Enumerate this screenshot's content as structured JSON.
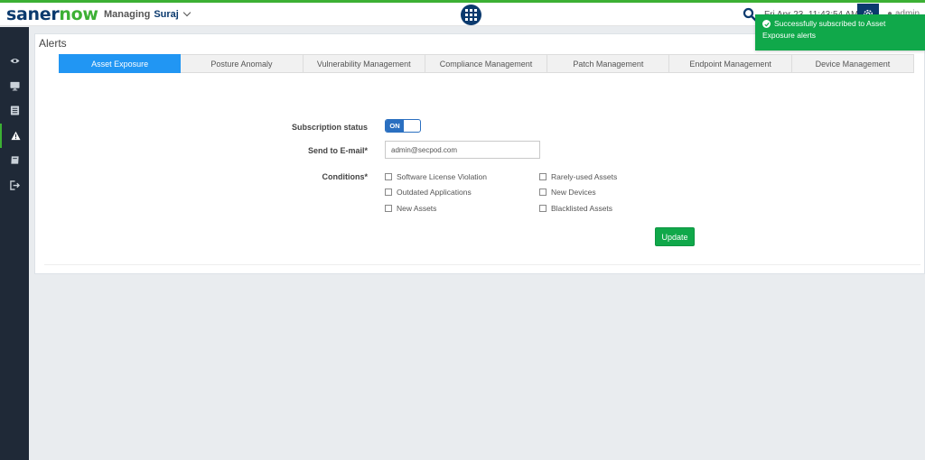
{
  "brand": {
    "logo_part1": "saner",
    "logo_part2": "now"
  },
  "header": {
    "managing_label": "Managing",
    "account": "Suraj",
    "datetime": "Fri Apr 23, 11:43:54 AM",
    "user": "admin"
  },
  "icons": {
    "apps": "grid-icon",
    "search": "search-icon",
    "settings": "gear-icon",
    "user": "user-icon",
    "success": "check-circle-icon"
  },
  "sidebar": {
    "items": [
      {
        "icon": "eye-icon",
        "active": false
      },
      {
        "icon": "monitor-icon",
        "active": false
      },
      {
        "icon": "report-icon",
        "active": false
      },
      {
        "icon": "warning-icon",
        "active": true
      },
      {
        "icon": "book-icon",
        "active": false
      },
      {
        "icon": "logout-icon",
        "active": false
      }
    ]
  },
  "page": {
    "title": "Alerts"
  },
  "tabs": [
    {
      "label": "Asset Exposure",
      "active": true
    },
    {
      "label": "Posture Anomaly",
      "active": false
    },
    {
      "label": "Vulnerability Management",
      "active": false
    },
    {
      "label": "Compliance Management",
      "active": false
    },
    {
      "label": "Patch Management",
      "active": false
    },
    {
      "label": "Endpoint Management",
      "active": false
    },
    {
      "label": "Device Management",
      "active": false
    }
  ],
  "form": {
    "subscription_label": "Subscription status",
    "subscription_value": "ON",
    "email_label": "Send to E-mail*",
    "email_value": "admin@secpod.com",
    "conditions_label": "Conditions*",
    "conditions": [
      {
        "label": "Software License Violation",
        "checked": false
      },
      {
        "label": "Outdated Applications",
        "checked": false
      },
      {
        "label": "New Assets",
        "checked": false
      },
      {
        "label": "Rarely-used Assets",
        "checked": false
      },
      {
        "label": "New Devices",
        "checked": false
      },
      {
        "label": "Blacklisted Assets",
        "checked": false
      }
    ],
    "update_label": "Update"
  },
  "toast": {
    "line1": "Successfully subscribed to Asset",
    "line2": "Exposure alerts"
  },
  "colors": {
    "brand_navy": "#0b3a6e",
    "brand_green": "#3cb034",
    "tab_active": "#2196f3",
    "toggle_on": "#2a6fc0",
    "success": "#10a84a",
    "sidebar": "#1f2937"
  }
}
